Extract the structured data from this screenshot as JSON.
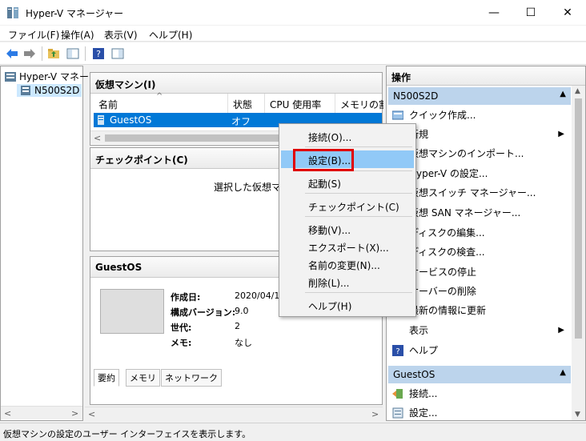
{
  "window": {
    "title": "Hyper-V マネージャー",
    "minimize": "—",
    "maximize": "☐",
    "close": "✕"
  },
  "menu": [
    "ファイル(F)",
    "操作(A)",
    "表示(V)",
    "ヘルプ(H)"
  ],
  "tree": {
    "root": "Hyper-V マネー",
    "host": "N500S2D"
  },
  "vm_pane": {
    "title": "仮想マシン(I)",
    "columns": [
      "名前",
      "状態",
      "CPU 使用率",
      "メモリの割り"
    ],
    "rows": [
      {
        "name": "GuestOS",
        "state": "オフ"
      }
    ]
  },
  "checkpoint_pane": {
    "title": "チェックポイント(C)",
    "message": "選択した仮想マシ"
  },
  "details_pane": {
    "title": "GuestOS",
    "fields": [
      {
        "label": "作成日:",
        "value": "2020/04/1"
      },
      {
        "label": "構成バージョン:",
        "value": "9.0"
      },
      {
        "label": "世代:",
        "value": "2"
      },
      {
        "label": "メモ:",
        "value": "なし"
      }
    ],
    "tabs": [
      "要約",
      "メモリ",
      "ネットワーク"
    ]
  },
  "actions": {
    "title": "操作",
    "host_section": "N500S2D",
    "host_items": [
      "クイック作成...",
      "新規",
      "仮想マシンのインポート...",
      "Hyper-V の設定...",
      "仮想スイッチ マネージャー...",
      "仮想 SAN マネージャー...",
      "ディスクの編集...",
      "ディスクの検査...",
      "サービスの停止",
      "サーバーの削除",
      "最新の情報に更新",
      "表示",
      "ヘルプ"
    ],
    "vm_section": "GuestOS",
    "vm_items": [
      "接続...",
      "設定..."
    ]
  },
  "context_menu": [
    "接続(O)...",
    "設定(B)...",
    "起動(S)",
    "チェックポイント(C)",
    "移動(V)...",
    "エクスポート(X)...",
    "名前の変更(N)...",
    "削除(L)...",
    "ヘルプ(H)"
  ],
  "status": "仮想マシンの設定のユーザー インターフェイスを表示します。",
  "colors": {
    "selection": "#0078d7",
    "section": "#bcd4ec",
    "menu_highlight": "#91c9f7",
    "callout": "#e00000"
  }
}
